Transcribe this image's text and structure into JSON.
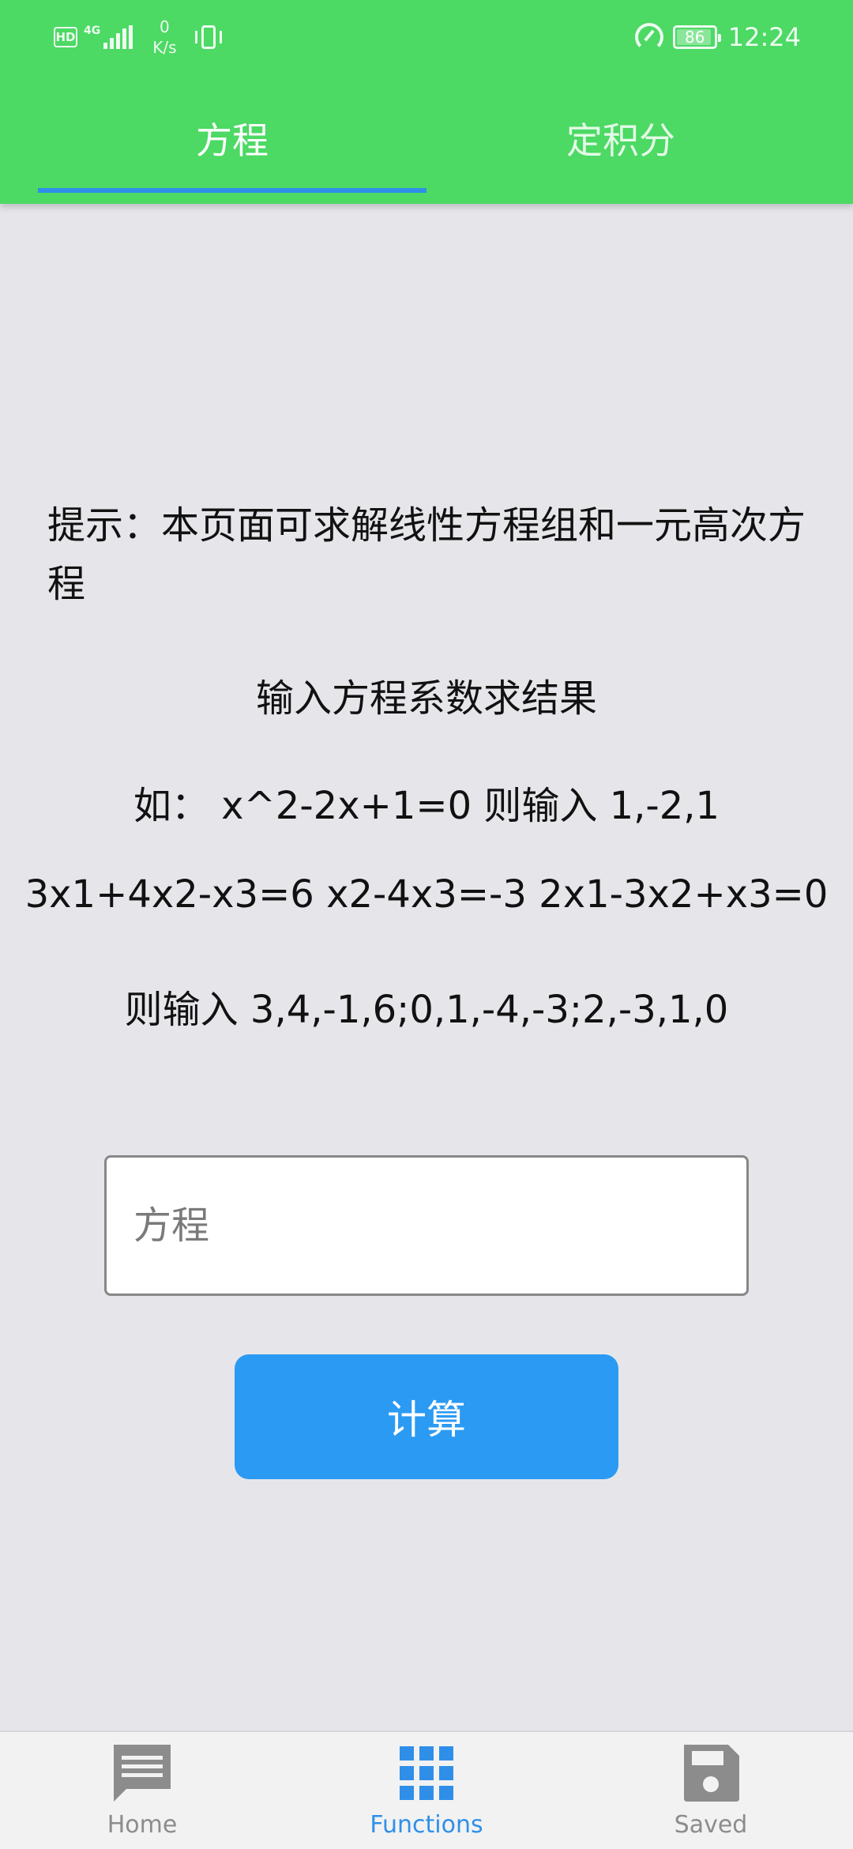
{
  "status_bar": {
    "hd_label": "HD",
    "network": "4G",
    "speed_value": "0",
    "speed_unit": "K/s",
    "battery": "86",
    "time": "12:24"
  },
  "tabs": [
    {
      "label": "方程",
      "active": true
    },
    {
      "label": "定积分",
      "active": false
    }
  ],
  "content": {
    "hint": "提示：本页面可求解线性方程组和一元高次方程",
    "instruction": "输入方程系数求结果",
    "example_1": "如：  x^2-2x+1=0 则输入 1,-2,1",
    "example_2": "3x1+4x2-x3=6   x2-4x3=-3   2x1-3x2+x3=0",
    "example_3": "则输入 3,4,-1,6;0,1,-4,-3;2,-3,1,0",
    "input_value": "",
    "input_placeholder": "方程",
    "calc_button_label": "计算"
  },
  "bottom_nav": [
    {
      "label": "Home",
      "icon": "message-icon",
      "active": false
    },
    {
      "label": "Functions",
      "icon": "grid-icon",
      "active": true
    },
    {
      "label": "Saved",
      "icon": "save-icon",
      "active": false
    }
  ],
  "colors": {
    "header": "#4cd964",
    "accent": "#2f8fe8",
    "button": "#2b9af3",
    "background": "#e6e6ea",
    "nav_inactive": "#8c8c8c"
  }
}
